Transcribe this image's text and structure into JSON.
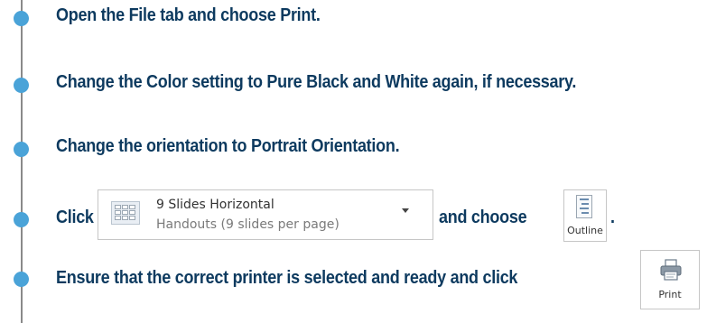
{
  "steps": [
    {
      "text": "Open the File tab and choose Print."
    },
    {
      "text": "Change the Color setting to Pure Black and White again, if necessary."
    },
    {
      "text": "Change the orientation to Portrait Orientation."
    },
    {
      "click": "Click",
      "and_choose": "and choose",
      "period": "."
    },
    {
      "text": "Ensure that the correct printer is selected and ready and click"
    }
  ],
  "handout_dropdown": {
    "title": "9 Slides Horizontal",
    "subtitle": "Handouts (9 slides per page)",
    "icon": "handout-grid-icon",
    "arrow_icon": "dropdown-arrow-icon"
  },
  "outline_button": {
    "label": "Outline",
    "icon": "outline-page-icon"
  },
  "print_button": {
    "label": "Print",
    "icon": "printer-icon"
  },
  "colors": {
    "text": "#0d3a5f",
    "bullet": "#4aa3d8",
    "timeline": "#8a8a8a"
  }
}
